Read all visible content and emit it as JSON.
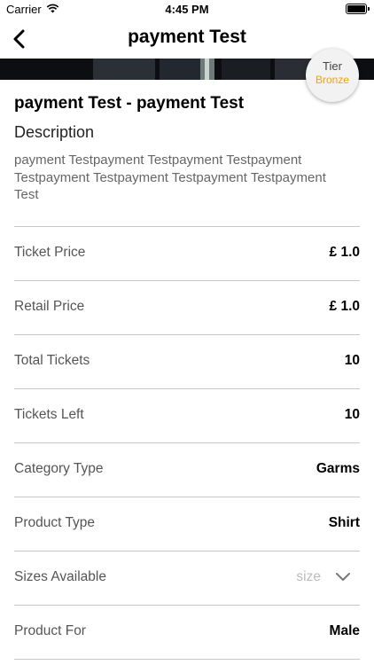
{
  "status_bar": {
    "carrier": "Carrier",
    "time": "4:45 PM"
  },
  "navbar": {
    "title": "payment Test"
  },
  "tier": {
    "label": "Tier",
    "level": "Bronze",
    "level_color": "#f0a500"
  },
  "product": {
    "title": "payment Test - payment Test",
    "description_label": "Description",
    "description": "payment Testpayment Testpayment Testpayment Testpayment Testpayment Testpayment Testpayment Test"
  },
  "details": [
    {
      "label": "Ticket Price",
      "value": "£ 1.0"
    },
    {
      "label": "Retail Price",
      "value": "£ 1.0"
    },
    {
      "label": "Total Tickets",
      "value": "10"
    },
    {
      "label": "Tickets Left",
      "value": "10"
    },
    {
      "label": "Category Type",
      "value": "Garms"
    },
    {
      "label": "Product Type",
      "value": "Shirt"
    },
    {
      "label": "Sizes Available",
      "placeholder": "size"
    },
    {
      "label": "Product For",
      "value": "Male"
    }
  ]
}
